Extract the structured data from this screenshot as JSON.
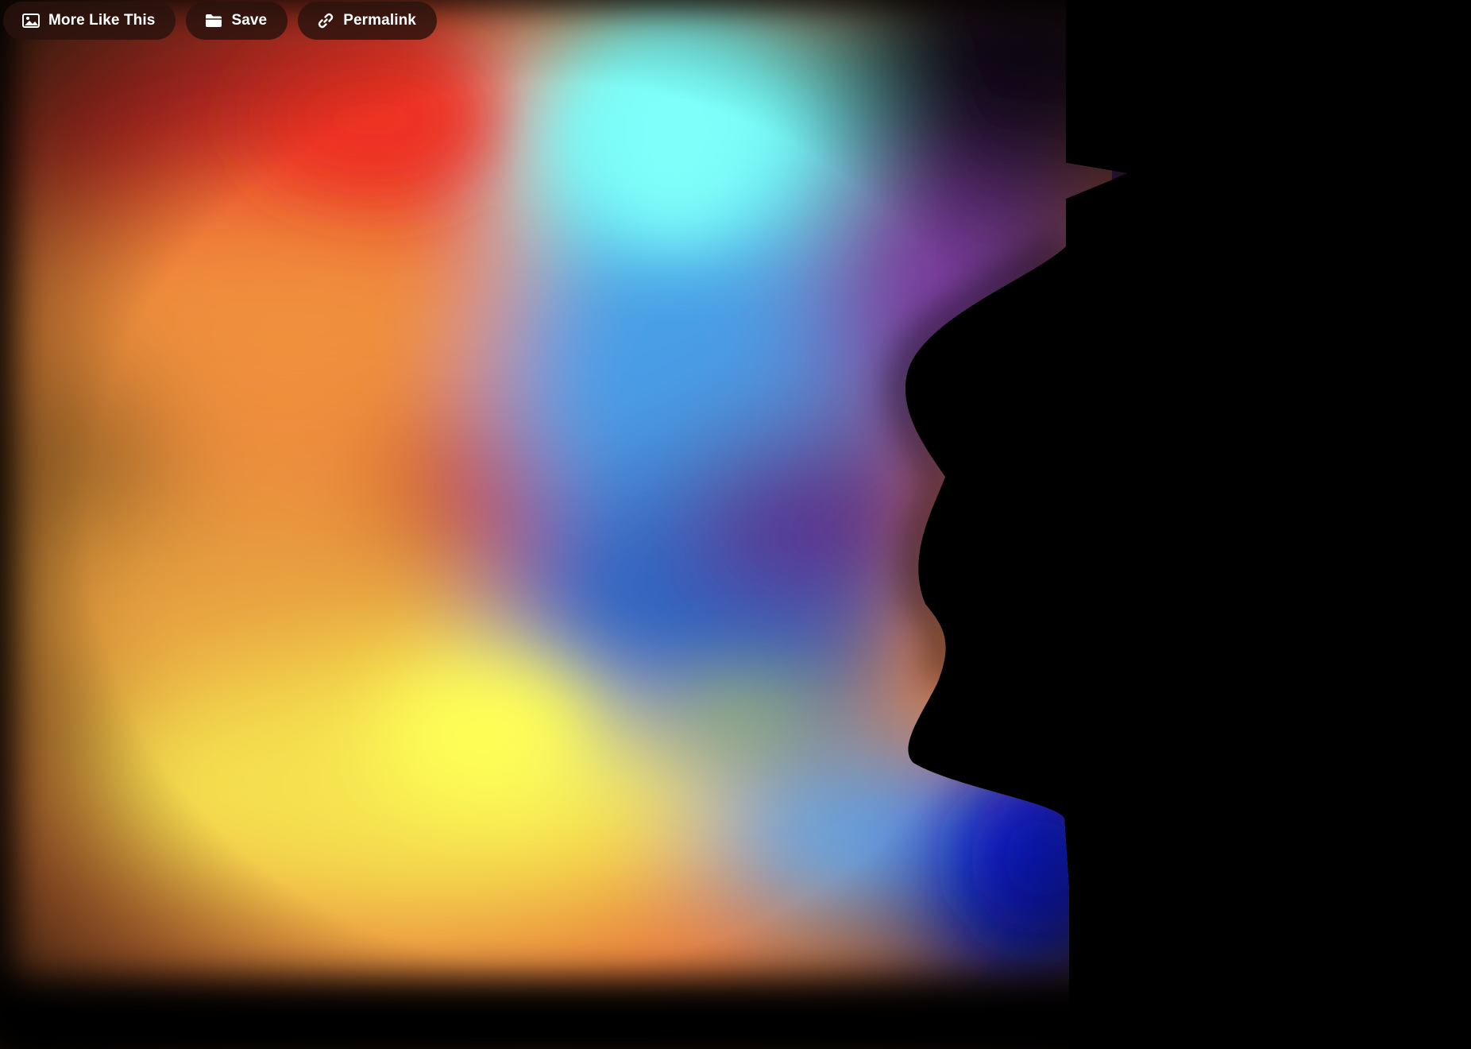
{
  "toolbar": {
    "buttons": [
      {
        "label": "More Like This",
        "icon": "image-icon"
      },
      {
        "label": "Save",
        "icon": "folder-icon"
      },
      {
        "label": "Permalink",
        "icon": "link-icon"
      }
    ]
  },
  "artwork": {
    "description_colors": {
      "background": "#000000",
      "red": "#e8302a",
      "orange": "#f08a3a",
      "yellow": "#fbee55",
      "cyan": "#6ffcf8",
      "sky_blue": "#4a9ee6",
      "blue": "#1f5fc0",
      "deep_blue": "#0520e8",
      "purple": "#8a3fa0",
      "violet": "#4a2a7a"
    }
  }
}
